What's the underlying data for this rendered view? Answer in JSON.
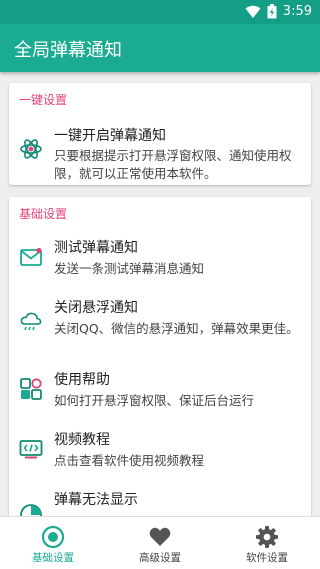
{
  "status": {
    "time": "3:59"
  },
  "appbar": {
    "title": "全局弹幕通知"
  },
  "section1": {
    "title": "一键设置",
    "item": {
      "title": "一键开启弹幕通知",
      "desc": "只要根据提示打开悬浮窗权限、通知使用权限，就可以正常使用本软件。",
      "icon": "atom-icon"
    }
  },
  "section2": {
    "title": "基础设置",
    "items": [
      {
        "title": "测试弹幕通知",
        "desc": "发送一条测试弹幕消息通知",
        "icon": "mail-icon"
      },
      {
        "title": "关闭悬浮通知",
        "desc": "关闭QQ、微信的悬浮通知，弹幕效果更佳。",
        "icon": "cloud-icon"
      },
      {
        "title": "使用帮助",
        "desc": "如何打开悬浮窗权限、保证后台运行",
        "icon": "apps-icon"
      },
      {
        "title": "视频教程",
        "desc": "点击查看软件使用视频教程",
        "icon": "video-icon"
      },
      {
        "title": "弹幕无法显示",
        "desc": "",
        "icon": "pie-icon"
      }
    ]
  },
  "nav": [
    {
      "label": "基础设置",
      "icon": "radio-icon",
      "active": true
    },
    {
      "label": "高级设置",
      "icon": "heart-icon",
      "active": false
    },
    {
      "label": "软件设置",
      "icon": "gear-icon",
      "active": false
    }
  ],
  "colors": {
    "primary": "#1aab92",
    "statusbar": "#149e86",
    "section_title": "#e5407a"
  }
}
